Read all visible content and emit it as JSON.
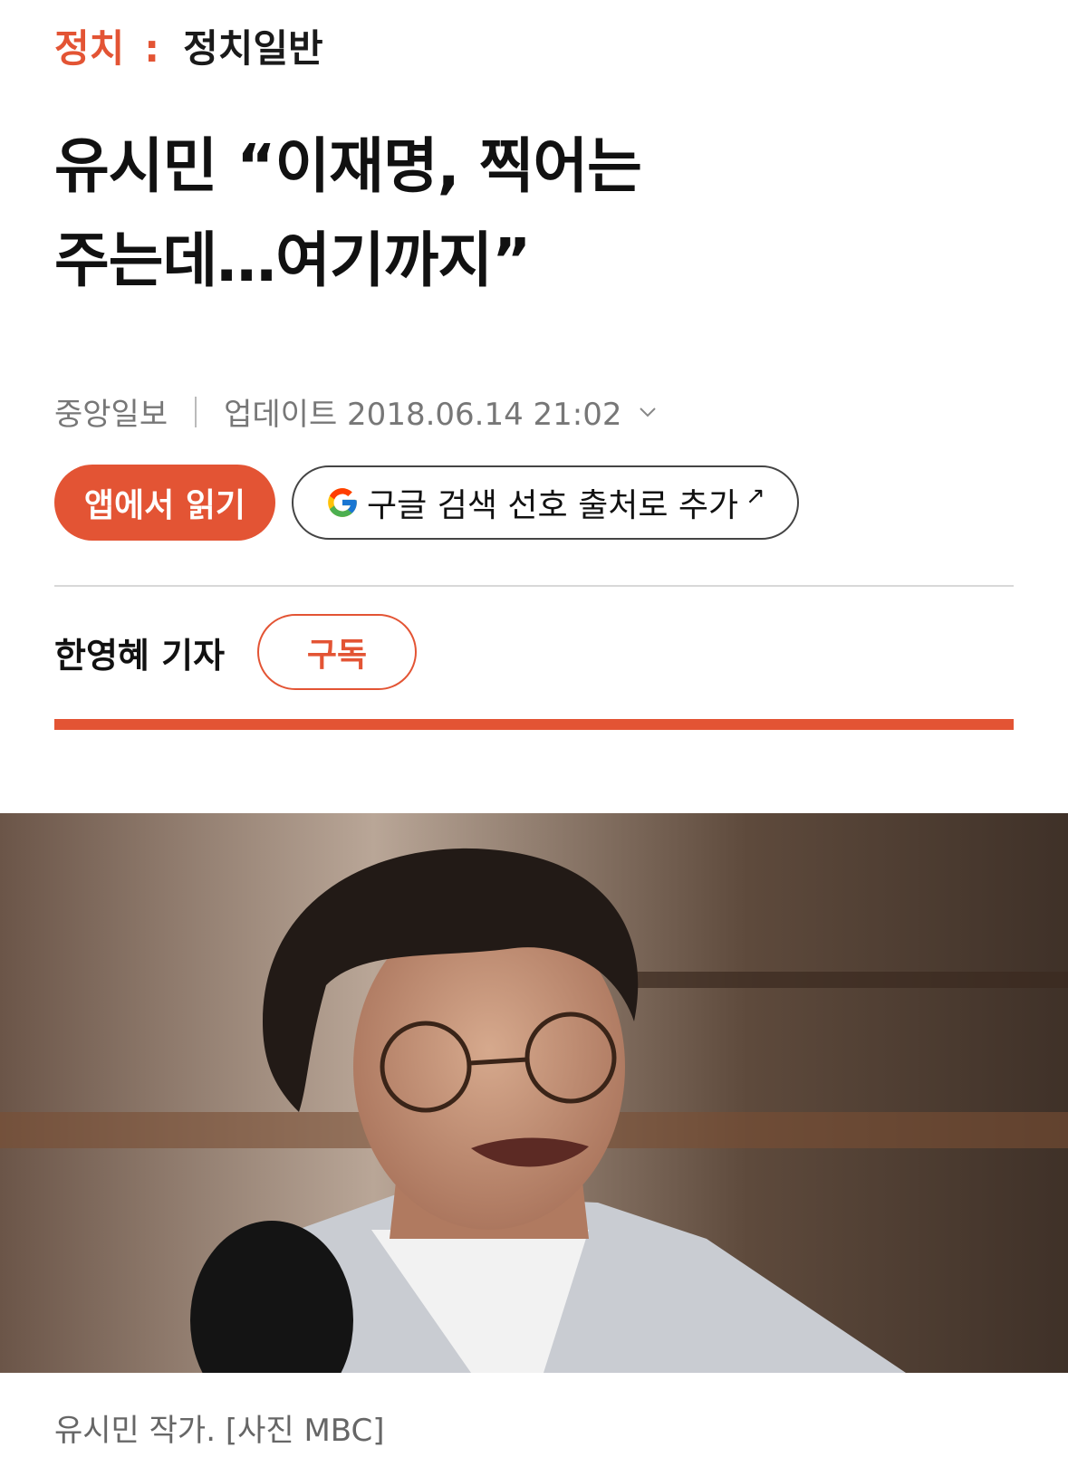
{
  "breadcrumb": {
    "category": "정치",
    "separator": ":",
    "subcategory": "정치일반"
  },
  "headline": {
    "line1": "유시민 “이재명, 찍어는",
    "line2": "주는데…여기까지”"
  },
  "meta": {
    "publisher": "중앙일보",
    "update_label": "업데이트 2018.06.14 21:02"
  },
  "buttons": {
    "app_read": "앱에서 읽기",
    "google_pref": "구글 검색 선호 출처로 추가",
    "google_arrow": "↗"
  },
  "reporter": {
    "name": "한영혜 기자",
    "subscribe": "구독"
  },
  "photo": {
    "caption": "유시민 작가. [사진 MBC]"
  },
  "colors": {
    "accent": "#e35434"
  }
}
